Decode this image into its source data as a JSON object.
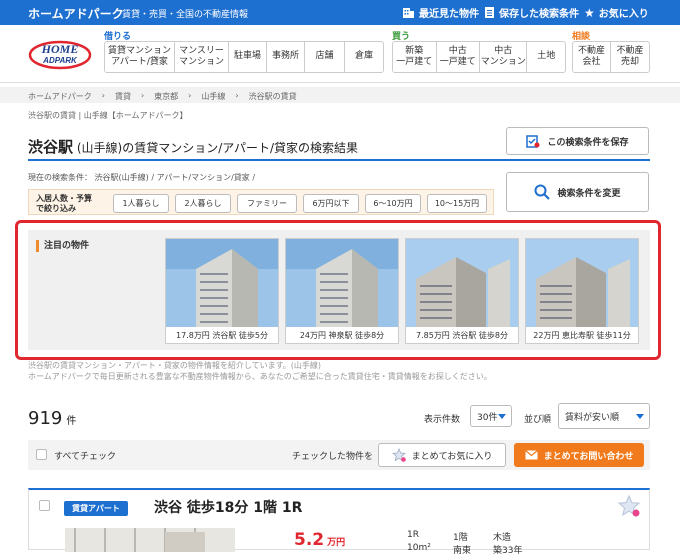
{
  "topbar": {
    "brand": "ホームアドパーク",
    "tagline": "賃貸・売買・全国の不動産情報",
    "links": [
      {
        "label": "最近見た物件",
        "icon": "building-icon"
      },
      {
        "label": "保存した検索条件",
        "icon": "document-icon"
      },
      {
        "label": "お気に入り",
        "icon": "star-icon"
      }
    ]
  },
  "logo": {
    "line1": "HOME",
    "line2": "ADPARK"
  },
  "nav": {
    "rent_label": "借りる",
    "rent_items": [
      "賃貸マンション\nアパート/貸家",
      "マンスリー\nマンション",
      "駐車場",
      "事務所",
      "店舗",
      "倉庫"
    ],
    "buy_label": "買う",
    "buy_items": [
      "新築\n一戸建て",
      "中古\n一戸建て",
      "中古\nマンション",
      "土地"
    ],
    "consult_label": "相談",
    "consult_items": [
      "不動産\n会社",
      "不動産\n売却"
    ]
  },
  "breadcrumb": [
    "ホームアドパーク",
    "賃貸",
    "東京都",
    "山手線",
    "渋谷駅の賃貸"
  ],
  "meta_text": "渋谷駅の賃貸 | 山手線【ホームアドパーク】",
  "page_title": {
    "main": "渋谷駅",
    "rest": " (山手線)の賃貸マンション/アパート/貸家の検索結果"
  },
  "save_search_label": "この検索条件を保存",
  "change_search_label": "検索条件を変更",
  "current_conditions": "現在の検索条件： 渋谷駅(山手線) / アパート/マンション/貸家 /",
  "filter": {
    "label": "入居人数・予算\nで絞り込み",
    "chips": [
      "1人暮らし",
      "2人暮らし",
      "ファミリー",
      "6万円以下",
      "6〜10万円",
      "10〜15万円"
    ]
  },
  "featured": {
    "label": "注目の物件",
    "cards": [
      {
        "caption": "17.8万円 渋谷駅 徒歩5分"
      },
      {
        "caption": "24万円 神泉駅 徒歩8分"
      },
      {
        "caption": "7.85万円 渋谷駅 徒歩8分"
      },
      {
        "caption": "22万円 恵比寿駅 徒歩11分"
      }
    ]
  },
  "description": {
    "line1": "渋谷駅の賃貸マンション・アパート・貸家の物件情報を紹介しています。(山手線)",
    "line2": "ホームアドパークで毎日更新される豊富な不動産物件情報から、あなたのご希望に合った賃貸住宅・賃貸情報をお探しください。"
  },
  "results": {
    "count": "919",
    "unit": "件",
    "per_page_label": "表示件数",
    "per_page_value": "30件",
    "sort_label": "並び順",
    "sort_value": "賃料が安い順"
  },
  "checkbar": {
    "check_all": "すべてチェック",
    "checked_label": "チェックした物件を",
    "fav_button": "まとめてお気に入り",
    "inquiry_button": "まとめてお問い合わせ"
  },
  "listing": {
    "type": "賃貸アパート",
    "title": "渋谷 徒歩18分 1階 1R",
    "price": "5.2",
    "price_unit": "万円",
    "layout": "1R",
    "area": "10m²",
    "floor": "1階",
    "direction": "南東",
    "structure": "木造",
    "age": "築33年"
  },
  "colors": {
    "brand_blue": "#1d6fd0",
    "accent_orange": "#f07a1c",
    "highlight_red": "#e0262e"
  }
}
